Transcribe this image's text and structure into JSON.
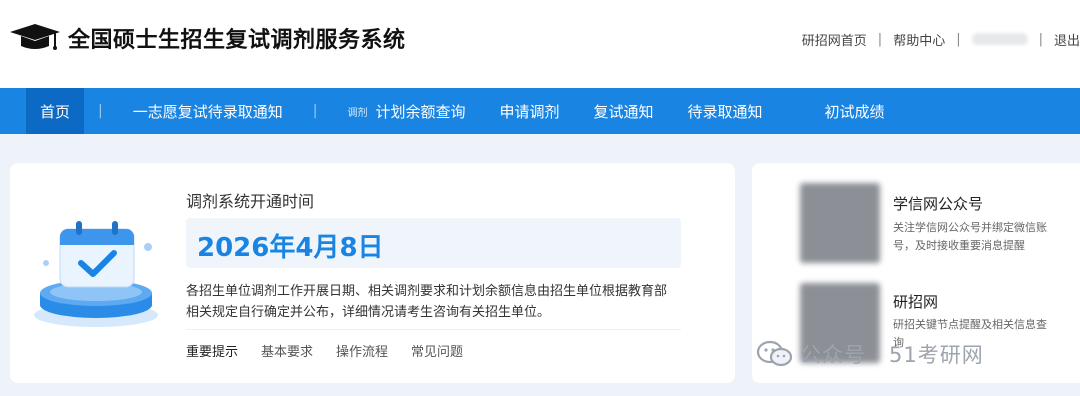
{
  "header": {
    "site_title": "全国硕士生招生复试调剂服务系统",
    "links": {
      "home": "研招网首页",
      "help": "帮助中心",
      "logout": "退出"
    }
  },
  "nav": {
    "items": [
      "首页",
      "一志愿复试待录取通知",
      "调剂",
      "计划余额查询",
      "申请调剂",
      "复试通知",
      "待录取通知",
      "初试成绩"
    ]
  },
  "notice_card": {
    "label": "调剂系统开通时间",
    "date": "2026年4月8日",
    "line1": "各招生单位调剂工作开展日期、相关调剂要求和计划余额信息由招生单位根据教育部",
    "line2": "相关规定自行确定并公布，详细情况请考生咨询有关招生单位。",
    "links": [
      "重要提示",
      "基本要求",
      "操作流程",
      "常见问题"
    ]
  },
  "follow_card": {
    "items": [
      {
        "title": "学信网公众号",
        "desc": "关注学信网公众号并绑定微信账号，及时接收重要消息提醒"
      },
      {
        "title": "研招网",
        "desc": "研招关键节点提醒及相关信息查询"
      }
    ]
  },
  "watermark": {
    "text": "公众号 · 51考研网"
  },
  "colors": {
    "nav_bg": "#1a84e3",
    "nav_active": "#0d6ac4",
    "accent": "#1a84e3",
    "page_bg": "#eef3f9"
  }
}
